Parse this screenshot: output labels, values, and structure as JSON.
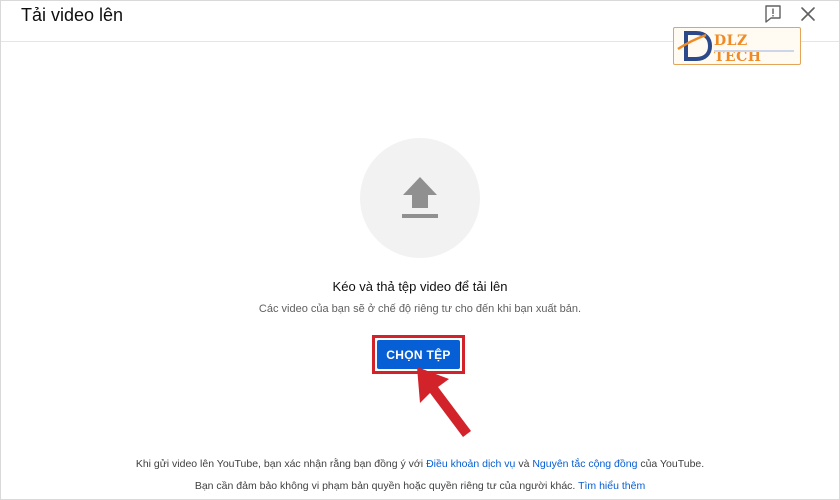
{
  "dialog": {
    "title": "Tải video lên"
  },
  "icons": {
    "feedback": "feedback-icon",
    "close": "close-icon",
    "upload": "upload-arrow-icon",
    "annotation": "red-arrow-icon"
  },
  "watermark": {
    "brand": "DLZ TECH"
  },
  "upload": {
    "drag_text": "Kéo và thả tệp video để tải lên",
    "privacy_text": "Các video của bạn sẽ ở chế độ riêng tư cho đến khi bạn xuất bản.",
    "select_button": "CHỌN TỆP"
  },
  "footer": {
    "terms_prefix": "Khi gửi video lên YouTube, bạn xác nhận rằng bạn đồng ý với",
    "terms_link": "Điều khoản dịch vụ",
    "terms_and": "và",
    "guidelines_link": "Nguyên tắc cộng đồng",
    "terms_suffix": "của YouTube.",
    "copyright_text": "Bạn cần đảm bảo không vi phạm bản quyền hoặc quyền riêng tư của người khác.",
    "learn_more_link": "Tìm hiểu thêm"
  },
  "colors": {
    "primary_button": "#065fd4",
    "link": "#065fd4",
    "highlight_border": "#d2222a",
    "upload_circle": "#f2f2f2",
    "brand_orange": "#f08a24"
  }
}
